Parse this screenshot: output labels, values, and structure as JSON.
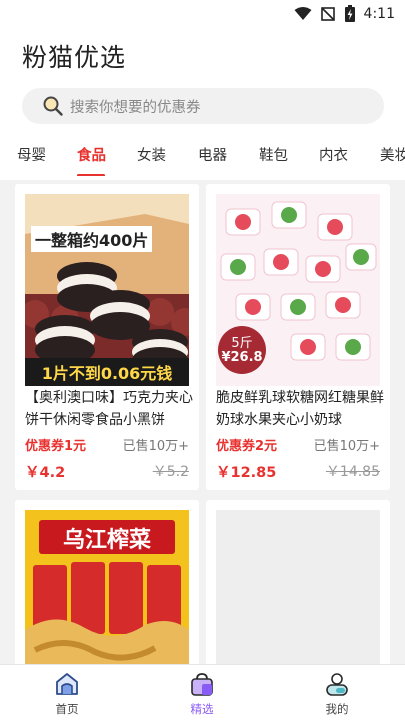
{
  "status": {
    "time": "4:11"
  },
  "app": {
    "title": "粉猫优选"
  },
  "search": {
    "placeholder": "搜索你想要的优惠券"
  },
  "tabs": [
    {
      "label": "母婴"
    },
    {
      "label": "食品",
      "active": true
    },
    {
      "label": "女装"
    },
    {
      "label": "电器"
    },
    {
      "label": "鞋包"
    },
    {
      "label": "内衣"
    },
    {
      "label": "美妆"
    }
  ],
  "products": [
    {
      "title": "【奥利澳口味】巧克力夹心饼干休闲零食品小黑饼",
      "coupon": "优惠券1元",
      "sold": "已售10万+",
      "price": "￥4.2",
      "old_price": "￥5.2",
      "image_text_top": "一整箱约400片",
      "image_text_bottom": "1片不到0.06元钱"
    },
    {
      "title": "脆皮鲜乳球软糖网红糖果鲜奶球水果夹心小奶球",
      "coupon": "优惠券2元",
      "sold": "已售10万+",
      "price": "￥12.85",
      "old_price": "￥14.85",
      "image_badge_top": "5斤",
      "image_badge_bottom": "¥26.8"
    },
    {
      "image_text_top": "乌江榨菜"
    },
    {}
  ],
  "nav": [
    {
      "label": "首页",
      "icon": "home-icon"
    },
    {
      "label": "精选",
      "icon": "bag-icon",
      "active": true
    },
    {
      "label": "我的",
      "icon": "user-icon"
    }
  ],
  "colors": {
    "accent": "#e8322f",
    "nav_active": "#8a5cf6"
  }
}
